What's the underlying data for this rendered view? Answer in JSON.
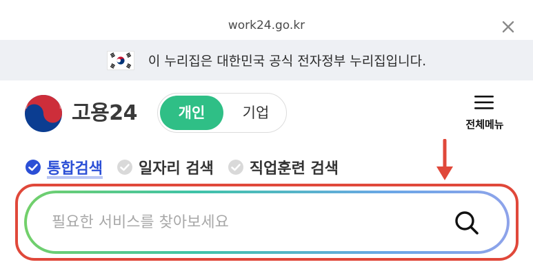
{
  "browser": {
    "url": "work24.go.kr",
    "close_icon": "close-icon"
  },
  "gov_banner": {
    "flag_icon": "korean-flag-icon",
    "text": "이 누리집은 대한민국 공식 전자정부 누리집입니다."
  },
  "header": {
    "logo_icon": "government-emblem-icon",
    "brand": "고용24",
    "toggle": {
      "personal": "개인",
      "business": "기업",
      "selected": "personal"
    },
    "menu": {
      "icon": "hamburger-menu-icon",
      "label": "전체메뉴"
    }
  },
  "annotation": {
    "arrow_icon": "arrow-down-icon",
    "arrow_color": "#e0483a",
    "box_color": "#e0483a"
  },
  "search": {
    "tabs": [
      {
        "label": "통합검색",
        "selected": true
      },
      {
        "label": "일자리 검색",
        "selected": false
      },
      {
        "label": "직업훈련 검색",
        "selected": false
      }
    ],
    "placeholder": "필요한 서비스를 찾아보세요",
    "value": "",
    "search_icon": "search-icon"
  },
  "colors": {
    "accent_green": "#2fbf86",
    "active_tab_blue": "#2b4fd6"
  }
}
